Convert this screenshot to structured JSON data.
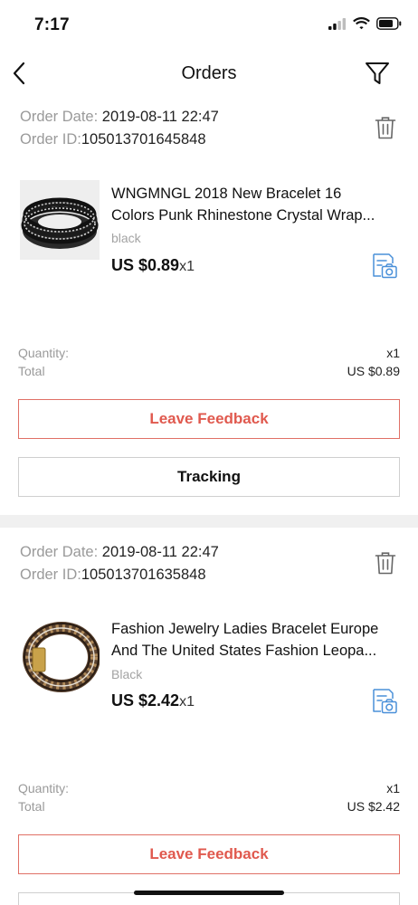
{
  "status_bar": {
    "time": "7:17"
  },
  "nav": {
    "title": "Orders"
  },
  "labels": {
    "order_date": "Order Date: ",
    "order_id": "Order ID:",
    "quantity": "Quantity:",
    "total": "Total",
    "leave_feedback": "Leave Feedback",
    "tracking": "Tracking"
  },
  "orders": [
    {
      "order_date": "2019-08-11 22:47",
      "order_id": "105013701645848",
      "title_line1": "WNGMNGL 2018 New Bracelet 16",
      "title_line2": "Colors Punk Rhinestone Crystal Wrap...",
      "variant": "black",
      "price": "US $0.89",
      "price_qty": "x1",
      "quantity": "x1",
      "total": "US $0.89"
    },
    {
      "order_date": "2019-08-11 22:47",
      "order_id": "105013701635848",
      "title_line1": "Fashion Jewelry Ladies Bracelet Europe",
      "title_line2": "And The United States Fashion Leopa...",
      "variant": "Black",
      "price": "US $2.42",
      "price_qty": "x1",
      "quantity": "x1",
      "total": "US $2.42"
    }
  ],
  "colors": {
    "accent_red": "#e0594e",
    "icon_blue": "#4a90d9",
    "muted_text": "#9a9a9a",
    "divider": "#f0f0f0"
  },
  "icons": {
    "back": "chevron-left-icon",
    "filter": "filter-icon",
    "delete": "trash-icon",
    "snapshot": "snapshot-icon"
  }
}
